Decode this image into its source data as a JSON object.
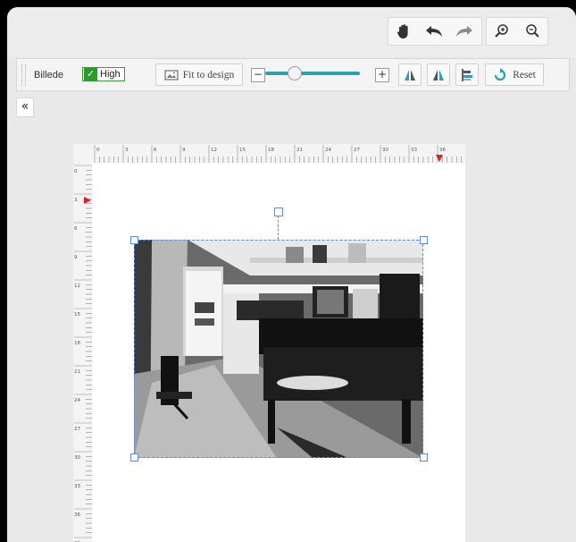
{
  "topbar": {
    "icons": [
      "hand-icon",
      "undo-icon",
      "redo-icon",
      "zoom-in-icon",
      "zoom-out-icon"
    ]
  },
  "toolbar": {
    "section_label": "Billede",
    "quality_label": "High",
    "quality_checked": true,
    "fit_label": "Fit to design",
    "minus_label": "−",
    "plus_label": "+",
    "zoom_level": 0.2,
    "reset_label": "Reset"
  },
  "ruler": {
    "unit": "cm",
    "horizontal": [
      "0",
      "3",
      "6",
      "9",
      "12",
      "15",
      "18",
      "21",
      "24",
      "27",
      "30",
      "33",
      "36",
      "39"
    ],
    "vertical": [
      "0",
      "3",
      "6",
      "9",
      "12",
      "15",
      "18",
      "21",
      "24",
      "27",
      "30",
      "33",
      "36",
      "39"
    ],
    "marker_h": "36",
    "marker_v": "3"
  },
  "colors": {
    "accent": "#2aa0b3",
    "check": "#2c9b2c",
    "marker": "#e02020",
    "selection": "#5b8fd6"
  }
}
